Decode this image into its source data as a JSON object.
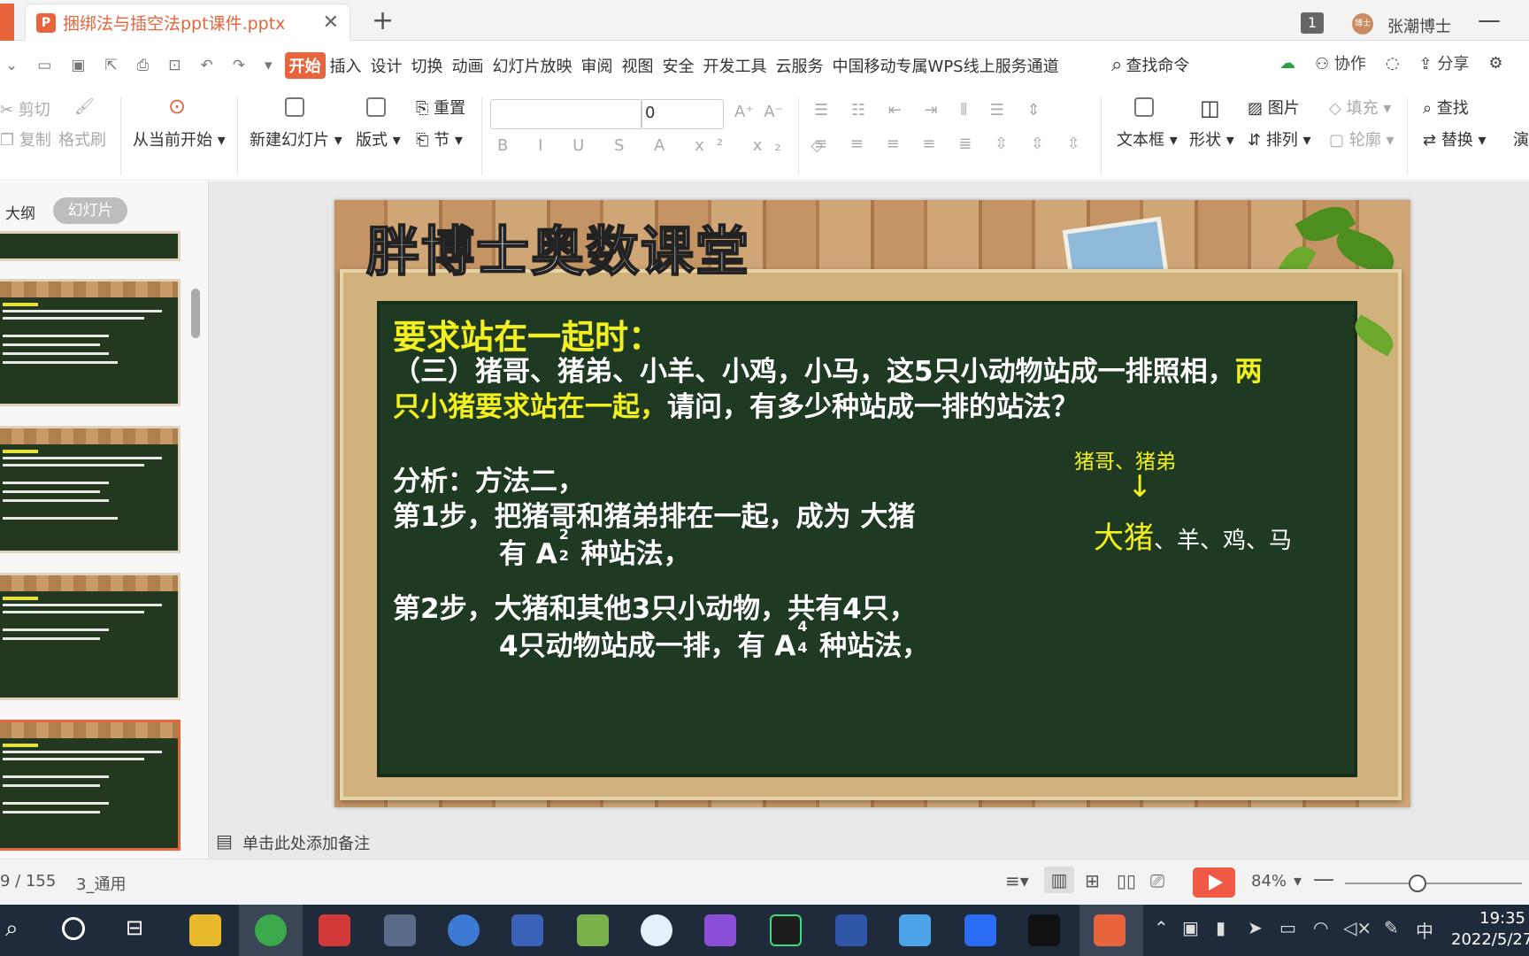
{
  "window": {
    "tab_title": "捆绑法与插空法ppt课件.pptx",
    "tab_close": "✕",
    "new_tab": "+",
    "badge": "1",
    "avatar_text": "博士",
    "user_name": "张潮博士",
    "minimize": "—"
  },
  "menu": {
    "items": [
      "开始",
      "插入",
      "设计",
      "切换",
      "动画",
      "幻灯片放映",
      "审阅",
      "视图",
      "安全",
      "开发工具",
      "云服务",
      "中国移动专属WPS线上服务通道"
    ],
    "search": "查找命令",
    "collab": "协作",
    "share": "分享"
  },
  "ribbon": {
    "cut": "剪切",
    "copy": "复制",
    "format_painter": "格式刷",
    "from_current": "从当前开始",
    "new_slide": "新建幻灯片",
    "layout": "版式",
    "reset": "重置",
    "section": "节",
    "font_size": "0",
    "textbox": "文本框",
    "shape": "形状",
    "arrange": "排列",
    "picture": "图片",
    "fill": "填充",
    "outline": "轮廓",
    "find": "查找",
    "replace": "替换",
    "more": "演"
  },
  "panel": {
    "outline_tab": "大纲",
    "slides_tab": "幻灯片"
  },
  "slide": {
    "title": "胖博士奥数课堂",
    "heading": "要求站在一起时：",
    "q_line1_white": "（三）猪哥、猪弟、小羊、小鸡，小马，这5只小动物站成一排照相，",
    "q_line1_yellow": "两",
    "q_line2_yellow": "只小猪要求站在一起，",
    "q_line2_white": "请问，有多少种站成一排的站法？",
    "analysis": "分析：方法二，",
    "step1": "第1步，把猪哥和猪弟排在一起，成为 大猪",
    "step1b_pre": "有 A",
    "step1b_sup": "2",
    "step1b_sub": "2",
    "step1b_post": " 种站法，",
    "step2": "第2步，大猪和其他3只小动物，共有4只，",
    "step2b_pre": "4只动物站成一排，有 A",
    "step2b_sup": "4",
    "step2b_sub": "4",
    "step2b_post": " 种站法，",
    "diagram_top": "猪哥、猪弟",
    "diagram_arrow": "↓",
    "diagram_big": "大猪",
    "diagram_rest": "、羊、鸡、马"
  },
  "notes": {
    "placeholder": "单击此处添加备注"
  },
  "status": {
    "page": "9 / 155",
    "theme": "3_通用",
    "zoom": "84%"
  },
  "taskbar": {
    "time": "19:35",
    "date": "2022/5/27",
    "ime": "中"
  },
  "colors": {
    "accent": "#e8643c",
    "board": "#1f3a23",
    "slide_yellow": "#f2f01f"
  }
}
